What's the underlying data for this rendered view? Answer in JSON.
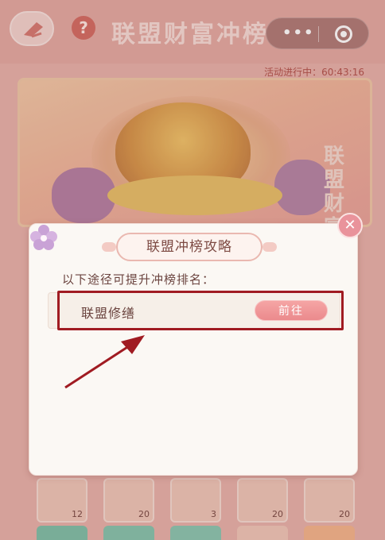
{
  "header": {
    "title": "联盟财富冲榜",
    "help_glyph": "?"
  },
  "capsule": {
    "menu_glyph": "•••"
  },
  "event": {
    "timer_text": "活动进行中：60:43:16",
    "banner_title": "联盟财富冲榜"
  },
  "rewards": {
    "row1_counts": [
      "12",
      "20",
      "3",
      "20",
      "20"
    ]
  },
  "popup": {
    "title": "联盟冲榜攻略",
    "intro": "以下途径可提升冲榜排名：",
    "routes": [
      {
        "label": "联盟修缮",
        "button": "前往"
      }
    ],
    "close_glyph": "✕"
  },
  "colors": {
    "highlight": "#a01b22",
    "button": "#eb8a8d",
    "page_bg": "#e7b2aa"
  },
  "icons": [
    "back-icon",
    "help-icon",
    "more-icon",
    "target-icon",
    "close-icon",
    "flower-icon",
    "arrow-icon"
  ]
}
